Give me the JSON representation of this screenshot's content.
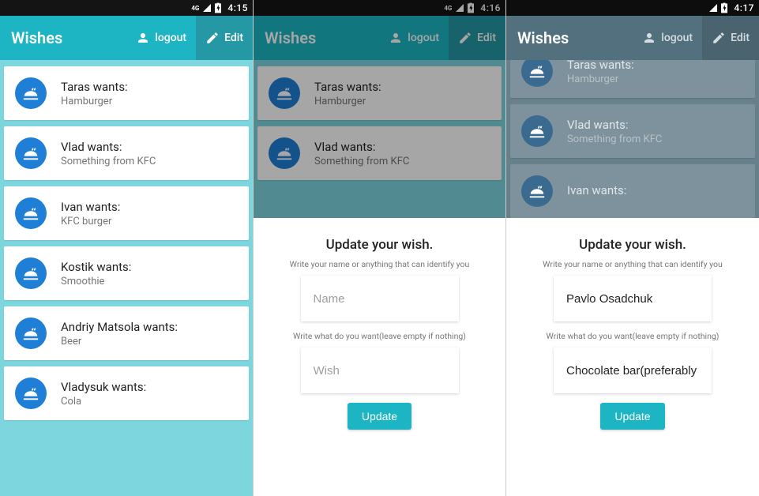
{
  "status": {
    "net_label": "4G",
    "times": {
      "p1": "4:15",
      "p2": "4:16",
      "p3": "4:17"
    }
  },
  "appbar": {
    "title": "Wishes",
    "logout_label": "logout",
    "edit_label": "Edit"
  },
  "wishes_full": [
    {
      "title": "Taras wants:",
      "sub": "Hamburger"
    },
    {
      "title": "Vlad wants:",
      "sub": "Something from KFC"
    },
    {
      "title": "Ivan wants:",
      "sub": "KFC burger"
    },
    {
      "title": "Kostik wants:",
      "sub": "Smoothie"
    },
    {
      "title": "Andriy Matsola wants:",
      "sub": "Beer"
    },
    {
      "title": "Vladysuk wants:",
      "sub": "Cola"
    }
  ],
  "wishes_p2": [
    {
      "title": "Taras wants:",
      "sub": "Hamburger"
    },
    {
      "title": "Vlad wants:",
      "sub": "Something from KFC"
    }
  ],
  "wishes_p3": [
    {
      "title": "Taras wants:",
      "sub": "Hamburger"
    },
    {
      "title": "Vlad wants:",
      "sub": "Something from KFC"
    },
    {
      "title": "Ivan wants:",
      "sub": ""
    }
  ],
  "sheet": {
    "title": "Update your wish.",
    "hint_name": "Write your name or anything that can identify you",
    "hint_wish": "Write what do you want(leave empty if nothing)",
    "placeholder_name": "Name",
    "placeholder_wish": "Wish",
    "update_label": "Update",
    "p3_name_value": "Pavlo Osadchuk",
    "p3_wish_value": "Chocolate bar(preferably"
  }
}
